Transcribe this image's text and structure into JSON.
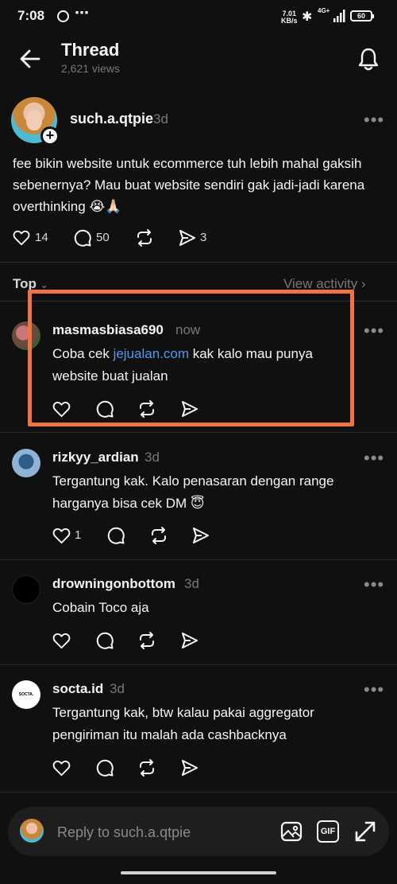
{
  "status_bar": {
    "time": "7:08",
    "more": "⋯",
    "speed": "7.01\nKB/s",
    "network": "4G+",
    "battery": "60"
  },
  "header": {
    "title": "Thread",
    "views": "2,621 views"
  },
  "post": {
    "username": "such.a.qtpie",
    "time": "3d",
    "text": "fee bikin website untuk ecommerce tuh lebih mahal gaksih sebenernya? Mau buat website sendiri gak jadi-jadi karena overthinking 😭🙏🏻",
    "likes": "14",
    "comments": "50",
    "shares": "3"
  },
  "sort": {
    "label": "Top",
    "view_activity": "View activity"
  },
  "replies": [
    {
      "username": "masmasbiasa690",
      "time": "now",
      "text_before": "Coba cek ",
      "link": "jejualan.com",
      "text_after": " kak kalo mau punya website buat jualan",
      "likes": ""
    },
    {
      "username": "rizkyy_ardian",
      "time": "3d",
      "text": "Tergantung kak. Kalo penasaran dengan range harganya bisa cek DM 😇",
      "likes": "1"
    },
    {
      "username": "drowningonbottom",
      "time": "3d",
      "text": "Cobain Toco aja",
      "likes": ""
    },
    {
      "username": "socta.id",
      "time": "3d",
      "text": "Tergantung kak, btw kalau pakai aggregator pengiriman itu malah ada cashbacknya",
      "likes": "",
      "avatar_text": "SOCTA."
    }
  ],
  "reply_bar": {
    "placeholder": "Reply to such.a.qtpie",
    "gif_label": "GIF"
  },
  "colors": {
    "background": "#101010",
    "highlight": "#f07443",
    "link": "#4d9bf0"
  }
}
